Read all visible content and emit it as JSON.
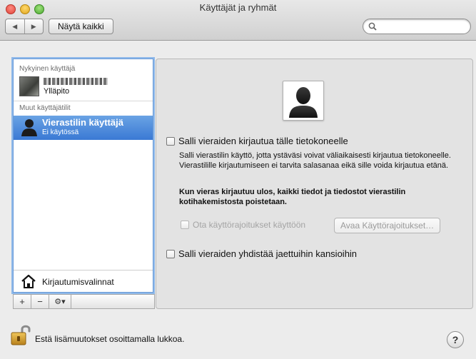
{
  "window": {
    "title": "Käyttäjät ja ryhmät"
  },
  "toolbar": {
    "show_all_label": "Näytä kaikki",
    "search_placeholder": ""
  },
  "sidebar": {
    "current_section": "Nykyinen käyttäjä",
    "current_user": {
      "role": "Ylläpito"
    },
    "other_section": "Muut käyttäjätilit",
    "guest": {
      "name": "Vierastilin käyttäjä",
      "status": "Ei käytössä"
    },
    "login_options_label": "Kirjautumisvalinnat",
    "add_label": "+",
    "remove_label": "−",
    "action_label": "⚙▾"
  },
  "main": {
    "allow_login_label": "Salli vieraiden kirjautua tälle tietokoneelle",
    "allow_login_desc": "Salli vierastilin käyttö, jotta ystäväsi voivat väliaikaisesti kirjautua tietokoneelle. Vierastilille kirjautumiseen ei tarvita salasanaa eikä sille voida kirjautua etänä.",
    "logout_warning": "Kun vieras kirjautuu ulos, kaikki tiedot ja tiedostot vierastilin kotihakemistosta poistetaan.",
    "parental_label": "Ota käyttörajoitukset käyttöön",
    "open_parental_label": "Avaa Käyttörajoitukset…",
    "shared_folders_label": "Salli vieraiden yhdistää jaettuihin kansioihin"
  },
  "footer": {
    "lock_text": "Estä lisämuutokset osoittamalla lukkoa.",
    "help_label": "?"
  }
}
